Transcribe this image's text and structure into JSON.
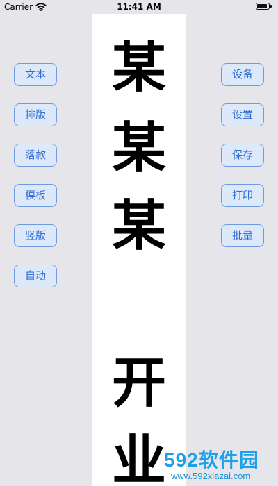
{
  "status_bar": {
    "carrier": "Carrier",
    "time": "11:41 AM"
  },
  "paper": {
    "characters": [
      "某",
      "某",
      "某",
      "开",
      "业"
    ]
  },
  "left_buttons": [
    "文本",
    "排版",
    "落款",
    "模板",
    "竖版",
    "自动"
  ],
  "right_buttons": [
    "设备",
    "设置",
    "保存",
    "打印",
    "批量"
  ],
  "watermark": {
    "main": "592软件园",
    "sub": "www.592xiazai.com"
  }
}
